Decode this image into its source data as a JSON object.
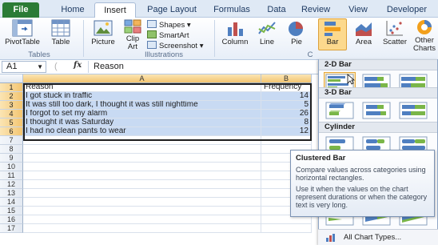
{
  "ribbon": {
    "tabs": [
      {
        "label": "File"
      },
      {
        "label": "Home"
      },
      {
        "label": "Insert"
      },
      {
        "label": "Page Layout"
      },
      {
        "label": "Formulas"
      },
      {
        "label": "Data"
      },
      {
        "label": "Review"
      },
      {
        "label": "View"
      },
      {
        "label": "Developer"
      }
    ],
    "active_tab": "Insert",
    "tables_group": {
      "pivot_label": "PivotTable",
      "table_label": "Table",
      "group_label": "Tables"
    },
    "illustrations_group": {
      "picture_label": "Picture",
      "clipart_line1": "Clip",
      "clipart_line2": "Art",
      "shapes_label": "Shapes ▾",
      "smartart_label": "SmartArt",
      "screenshot_label": "Screenshot ▾",
      "group_label": "Illustrations"
    },
    "charts_group": {
      "column_label": "Column",
      "line_label": "Line",
      "pie_label": "Pie",
      "bar_label": "Bar",
      "area_label": "Area",
      "scatter_label": "Scatter",
      "other_line1": "Other",
      "other_line2": "Charts",
      "group_label_fragment": "C"
    }
  },
  "formula_bar": {
    "name_box": "A1",
    "fx_label": "fx",
    "value": "Reason"
  },
  "sheet": {
    "columns": [
      "A",
      "B"
    ],
    "rows": [
      "1",
      "2",
      "3",
      "4",
      "5",
      "6",
      "7",
      "8",
      "9",
      "10",
      "11",
      "12",
      "13",
      "14",
      "15",
      "16",
      "17"
    ],
    "data": [
      {
        "reason": "Reason",
        "frequency": "Frequency"
      },
      {
        "reason": "I got stuck in traffic",
        "frequency": "14"
      },
      {
        "reason": "It was still too dark, I thought it was still nighttime",
        "frequency": "5"
      },
      {
        "reason": "I forgot to set my alarm",
        "frequency": "26"
      },
      {
        "reason": "I thought it was Saturday",
        "frequency": "8"
      },
      {
        "reason": "I had no clean pants to wear",
        "frequency": "12"
      }
    ]
  },
  "bar_dropdown": {
    "section_2d": "2-D Bar",
    "section_3d": "3-D Bar",
    "section_cylinder": "Cylinder",
    "all_chart_types": "All Chart Types...",
    "tooltip": {
      "title": "Clustered Bar",
      "line1": "Compare values across categories using horizontal rectangles.",
      "line2": "Use it when the values on the chart represent durations or when the category text is very long."
    }
  },
  "colors": {
    "file_tab": "#2b7b36",
    "selection": "#c8daf3",
    "hover": "#fde9bc",
    "accent_bar": "#f2a01c"
  }
}
